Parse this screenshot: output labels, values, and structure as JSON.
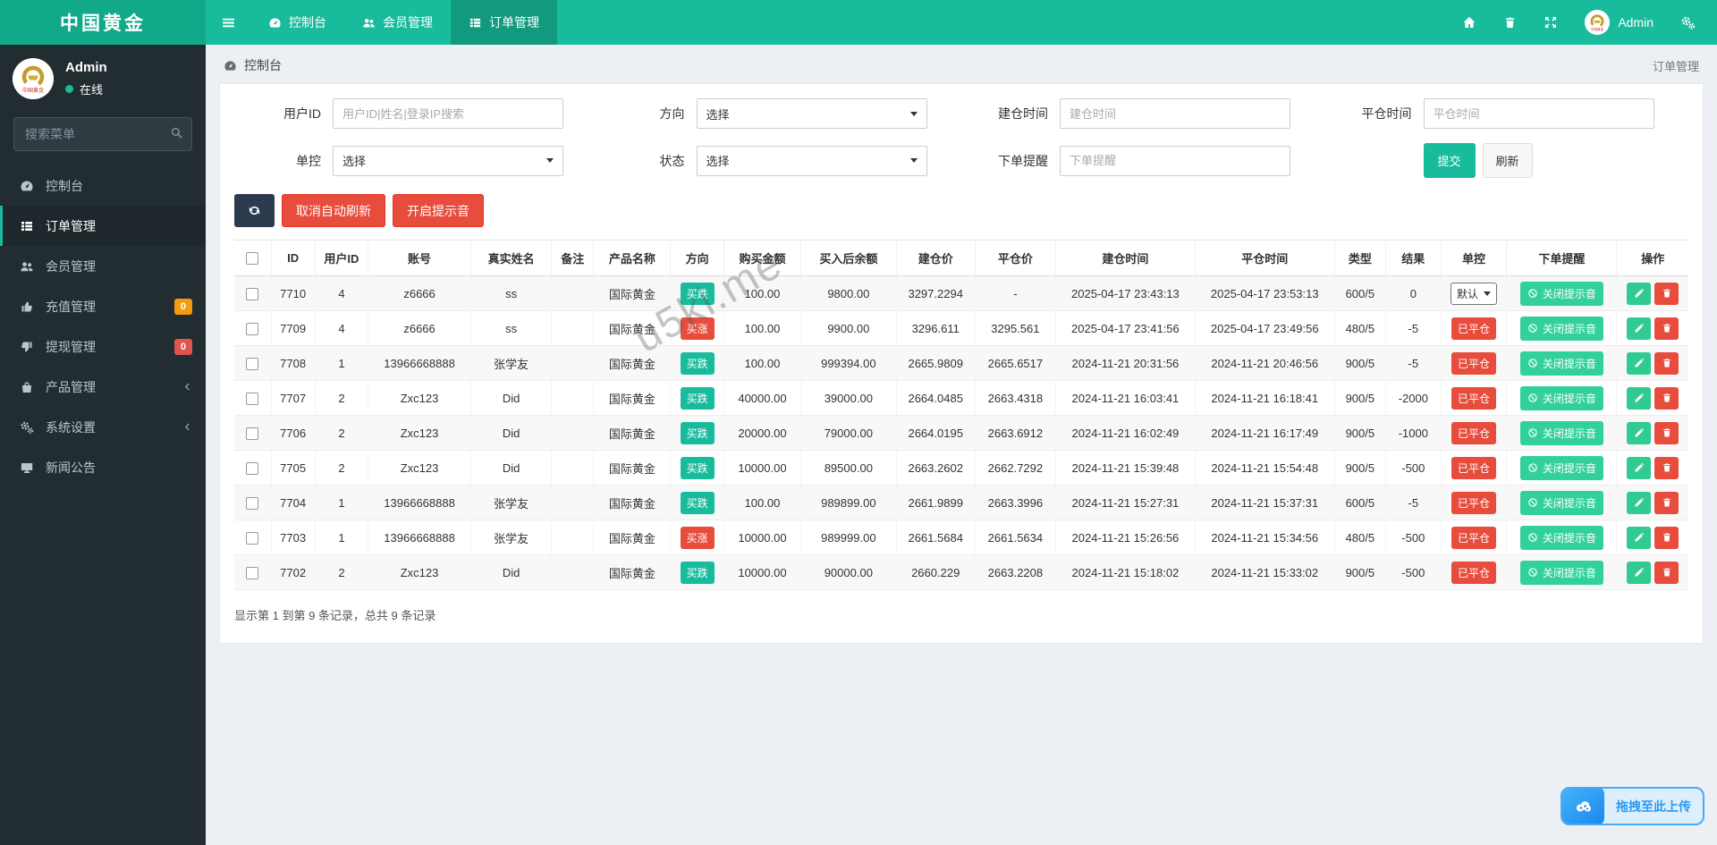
{
  "brand": {
    "title": "中国黄金"
  },
  "navbar": {
    "items": [
      {
        "label": "控制台",
        "icon": "dashboard-icon"
      },
      {
        "label": "会员管理",
        "icon": "users-icon"
      },
      {
        "label": "订单管理",
        "icon": "list-icon",
        "active": true
      }
    ],
    "user": "Admin"
  },
  "sidebar": {
    "user": {
      "name": "Admin",
      "status": "在线"
    },
    "search_placeholder": "搜索菜单",
    "items": [
      {
        "label": "控制台",
        "icon": "dashboard-icon"
      },
      {
        "label": "订单管理",
        "icon": "list-icon",
        "active": true
      },
      {
        "label": "会员管理",
        "icon": "users-icon"
      },
      {
        "label": "充值管理",
        "icon": "thumbs-up-icon",
        "badge": "0",
        "badge_color": "#f39c12"
      },
      {
        "label": "提现管理",
        "icon": "thumbs-down-icon",
        "badge": "0",
        "badge_color": "#e0534f"
      },
      {
        "label": "产品管理",
        "icon": "shopping-bag-icon",
        "chevron": true
      },
      {
        "label": "系统设置",
        "icon": "gears-icon",
        "chevron": true
      },
      {
        "label": "新闻公告",
        "icon": "tv-icon"
      }
    ]
  },
  "breadcrumb": {
    "left": "控制台",
    "right": "订单管理"
  },
  "filters": {
    "user_id": {
      "label": "用户ID",
      "placeholder": "用户ID|姓名|登录IP搜索"
    },
    "direction": {
      "label": "方向",
      "value": "选择"
    },
    "open_time": {
      "label": "建仓时间",
      "placeholder": "建仓时间"
    },
    "close_time": {
      "label": "平仓时间",
      "placeholder": "平仓时间"
    },
    "control": {
      "label": "单控",
      "value": "选择"
    },
    "status": {
      "label": "状态",
      "value": "选择"
    },
    "order_notice": {
      "label": "下单提醒",
      "placeholder": "下单提醒"
    },
    "submit_label": "提交",
    "refresh_label": "刷新"
  },
  "toolbar": {
    "cancel_auto_refresh": "取消自动刷新",
    "enable_sound": "开启提示音"
  },
  "table": {
    "columns": [
      "ID",
      "用户ID",
      "账号",
      "真实姓名",
      "备注",
      "产品名称",
      "方向",
      "购买金额",
      "买入后余额",
      "建仓价",
      "平仓价",
      "建仓时间",
      "平仓时间",
      "类型",
      "结果",
      "单控",
      "下单提醒",
      "操作"
    ],
    "mute_button_label": "关闭提示音",
    "rows": [
      {
        "id": "7710",
        "uid": "4",
        "account": "z6666",
        "name": "ss",
        "remark": "",
        "product": "国际黄金",
        "direction": "买跌",
        "direction_type": "green",
        "amount": "100.00",
        "balance": "9800.00",
        "open_price": "3297.2294",
        "close_price": "-",
        "open_time": "2025-04-17 23:43:13",
        "close_time": "2025-04-17 23:53:13",
        "type": "600/5",
        "result": "0",
        "control": "默认",
        "control_type": "select"
      },
      {
        "id": "7709",
        "uid": "4",
        "account": "z6666",
        "name": "ss",
        "remark": "",
        "product": "国际黄金",
        "direction": "买涨",
        "direction_type": "red",
        "amount": "100.00",
        "balance": "9900.00",
        "open_price": "3296.611",
        "close_price": "3295.561",
        "open_time": "2025-04-17 23:41:56",
        "close_time": "2025-04-17 23:49:56",
        "type": "480/5",
        "result": "-5",
        "control": "已平仓",
        "control_type": "badge"
      },
      {
        "id": "7708",
        "uid": "1",
        "account": "13966668888",
        "name": "张学友",
        "remark": "",
        "product": "国际黄金",
        "direction": "买跌",
        "direction_type": "green",
        "amount": "100.00",
        "balance": "999394.00",
        "open_price": "2665.9809",
        "close_price": "2665.6517",
        "open_time": "2024-11-21 20:31:56",
        "close_time": "2024-11-21 20:46:56",
        "type": "900/5",
        "result": "-5",
        "control": "已平仓",
        "control_type": "badge"
      },
      {
        "id": "7707",
        "uid": "2",
        "account": "Zxc123",
        "name": "Did",
        "remark": "",
        "product": "国际黄金",
        "direction": "买跌",
        "direction_type": "green",
        "amount": "40000.00",
        "balance": "39000.00",
        "open_price": "2664.0485",
        "close_price": "2663.4318",
        "open_time": "2024-11-21 16:03:41",
        "close_time": "2024-11-21 16:18:41",
        "type": "900/5",
        "result": "-2000",
        "control": "已平仓",
        "control_type": "badge"
      },
      {
        "id": "7706",
        "uid": "2",
        "account": "Zxc123",
        "name": "Did",
        "remark": "",
        "product": "国际黄金",
        "direction": "买跌",
        "direction_type": "green",
        "amount": "20000.00",
        "balance": "79000.00",
        "open_price": "2664.0195",
        "close_price": "2663.6912",
        "open_time": "2024-11-21 16:02:49",
        "close_time": "2024-11-21 16:17:49",
        "type": "900/5",
        "result": "-1000",
        "control": "已平仓",
        "control_type": "badge"
      },
      {
        "id": "7705",
        "uid": "2",
        "account": "Zxc123",
        "name": "Did",
        "remark": "",
        "product": "国际黄金",
        "direction": "买跌",
        "direction_type": "green",
        "amount": "10000.00",
        "balance": "89500.00",
        "open_price": "2663.2602",
        "close_price": "2662.7292",
        "open_time": "2024-11-21 15:39:48",
        "close_time": "2024-11-21 15:54:48",
        "type": "900/5",
        "result": "-500",
        "control": "已平仓",
        "control_type": "badge"
      },
      {
        "id": "7704",
        "uid": "1",
        "account": "13966668888",
        "name": "张学友",
        "remark": "",
        "product": "国际黄金",
        "direction": "买跌",
        "direction_type": "green",
        "amount": "100.00",
        "balance": "989899.00",
        "open_price": "2661.9899",
        "close_price": "2663.3996",
        "open_time": "2024-11-21 15:27:31",
        "close_time": "2024-11-21 15:37:31",
        "type": "600/5",
        "result": "-5",
        "control": "已平仓",
        "control_type": "badge"
      },
      {
        "id": "7703",
        "uid": "1",
        "account": "13966668888",
        "name": "张学友",
        "remark": "",
        "product": "国际黄金",
        "direction": "买涨",
        "direction_type": "red",
        "amount": "10000.00",
        "balance": "989999.00",
        "open_price": "2661.5684",
        "close_price": "2661.5634",
        "open_time": "2024-11-21 15:26:56",
        "close_time": "2024-11-21 15:34:56",
        "type": "480/5",
        "result": "-500",
        "control": "已平仓",
        "control_type": "badge"
      },
      {
        "id": "7702",
        "uid": "2",
        "account": "Zxc123",
        "name": "Did",
        "remark": "",
        "product": "国际黄金",
        "direction": "买跌",
        "direction_type": "green",
        "amount": "10000.00",
        "balance": "90000.00",
        "open_price": "2660.229",
        "close_price": "2663.2208",
        "open_time": "2024-11-21 15:18:02",
        "close_time": "2024-11-21 15:33:02",
        "type": "900/5",
        "result": "-500",
        "control": "已平仓",
        "control_type": "badge"
      }
    ]
  },
  "footer": {
    "summary": "显示第 1 到第 9 条记录，总共 9 条记录"
  },
  "watermark": "u5ki.me",
  "upload": {
    "label": "拖拽至此上传"
  },
  "colors": {
    "accent": "#18bc9c",
    "navbar": "#18bc9c",
    "sidebar_bg": "#222d32",
    "danger": "#e74c3c",
    "green_button": "#33d19a",
    "warning_badge": "#f39c12",
    "upload_blue": "#2a9af3"
  }
}
